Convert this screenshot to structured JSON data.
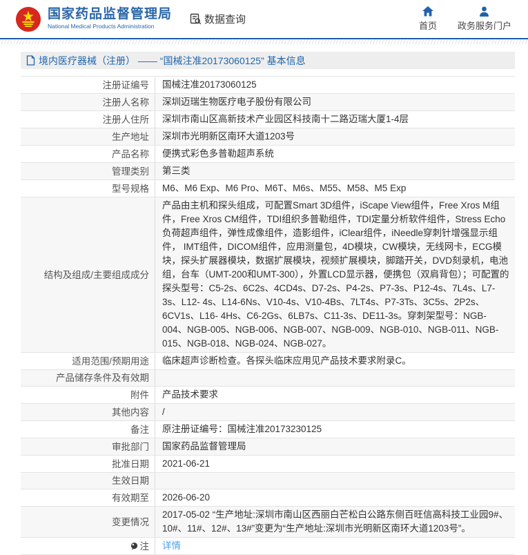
{
  "header": {
    "agency_title": "国家药品监督管理局",
    "agency_subtitle": "National Medical Products Administration",
    "data_query_label": "数据查询",
    "nav": [
      {
        "label": "首页",
        "icon": "home-icon"
      },
      {
        "label": "政务服务门户",
        "icon": "user-icon"
      }
    ]
  },
  "colors": {
    "brand_blue": "#2a66a8",
    "nav_icon_blue": "#2062ac",
    "emblem_red": "#d5281e",
    "emblem_yellow": "#ffde00",
    "link_blue": "#4a9fe8",
    "breadcrumb_bg": "#eeeeee",
    "border_gray": "#e4e4e4"
  },
  "breadcrumb": "境内医疗器械（注册） —— “国械注准20173060125” 基本信息",
  "table": {
    "rows": [
      {
        "label": "注册证编号",
        "value": "国械注准20173060125"
      },
      {
        "label": "注册人名称",
        "value": "深圳迈瑞生物医疗电子股份有限公司"
      },
      {
        "label": "注册人住所",
        "value": "深圳市南山区高新技术产业园区科技南十二路迈瑞大厦1-4层"
      },
      {
        "label": "生产地址",
        "value": "深圳市光明新区南环大道1203号"
      },
      {
        "label": "产品名称",
        "value": "便携式彩色多普勒超声系统"
      },
      {
        "label": "管理类别",
        "value": "第三类"
      },
      {
        "label": "型号规格",
        "value": "M6、M6 Exp、M6 Pro、M6T、M6s、M55、M58、M5 Exp"
      },
      {
        "label": "结构及组成/主要组成成分",
        "value": "产品由主机和探头组成，可配置Smart 3D组件，iScape View组件，Free Xros M组件，Free Xros CM组件，TDI组织多普勒组件，TDI定量分析软件组件，Stress Echo负荷超声组件，弹性成像组件，造影组件，iClear组件，iNeedle穿刺针增强显示组件， IMT组件，DICOM组件，应用测量包，4D模块，CW模块，无线网卡，ECG模块，探头扩展器模块，数据扩展模块，视频扩展模块，脚踏开关，DVD刻录机，电池组，台车（UMT-200和UMT-300），外置LCD显示器，便携包（双肩背包）；可配置的探头型号：C5-2s、6C2s、4CD4s、D7-2s、P4-2s、P7-3s、P12-4s、7L4s、L7-3s、L12- 4s、L14-6Ns、V10-4s、V10-4Bs、7LT4s、P7-3Ts、3C5s、2P2s、6CV1s、L16- 4Hs、C6-2Gs、6LB7s、C11-3s、DE11-3s。穿刺架型号：NGB-004、NGB-005、NGB-006、NGB-007、NGB-009、NGB-010、NGB-011、NGB-015、NGB-018、NGB-024、NGB-027。"
      },
      {
        "label": "适用范围/预期用途",
        "value": "临床超声诊断检查。各探头临床应用见产品技术要求附录C。"
      },
      {
        "label": "产品储存条件及有效期",
        "value": ""
      },
      {
        "label": "附件",
        "value": "产品技术要求"
      },
      {
        "label": "其他内容",
        "value": "/"
      },
      {
        "label": "备注",
        "value": "原注册证编号：国械注准20173230125"
      },
      {
        "label": "审批部门",
        "value": "国家药品监督管理局"
      },
      {
        "label": "批准日期",
        "value": "2021-06-21"
      },
      {
        "label": "生效日期",
        "value": ""
      },
      {
        "label": "有效期至",
        "value": "2026-06-20"
      },
      {
        "label": "变更情况",
        "value": "2017-05-02 “生产地址:深圳市南山区西丽白芒松白公路东侧百旺信高科技工业园9#、10#、11#、12#、13#”变更为“生产地址:深圳市光明新区南环大道1203号”。"
      },
      {
        "label": "注",
        "value": "详情",
        "link": true,
        "note_icon": true
      }
    ]
  }
}
